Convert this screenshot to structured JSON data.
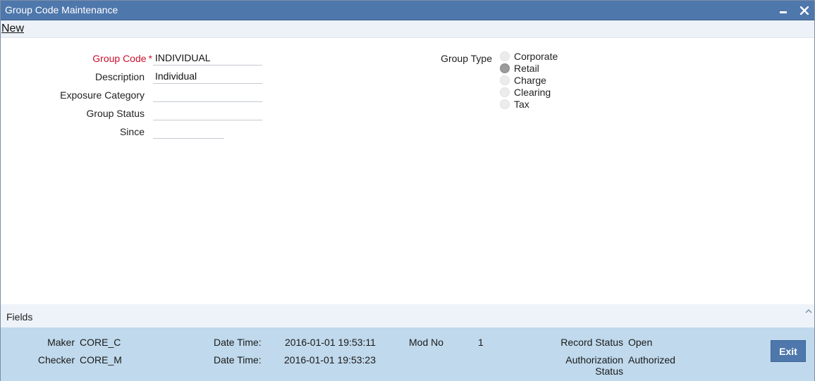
{
  "window": {
    "title": "Group Code Maintenance"
  },
  "menubar": {
    "new_label": "New"
  },
  "form": {
    "group_code": {
      "label": "Group Code",
      "required_mark": "*",
      "value": "INDIVIDUAL"
    },
    "description": {
      "label": "Description",
      "value": "Individual"
    },
    "exposure_category": {
      "label": "Exposure Category",
      "value": ""
    },
    "group_status": {
      "label": "Group Status",
      "value": ""
    },
    "since": {
      "label": "Since",
      "value": ""
    }
  },
  "group_type": {
    "label": "Group Type",
    "options": [
      {
        "label": "Corporate",
        "checked": false
      },
      {
        "label": "Retail",
        "checked": true
      },
      {
        "label": "Charge",
        "checked": false
      },
      {
        "label": "Clearing",
        "checked": false
      },
      {
        "label": "Tax",
        "checked": false
      }
    ]
  },
  "fields_section": {
    "label": "Fields"
  },
  "footer": {
    "maker_label": "Maker",
    "maker_value": "CORE_C",
    "checker_label": "Checker",
    "checker_value": "CORE_M",
    "maker_datetime_label": "Date Time:",
    "maker_datetime_value": "2016-01-01 19:53:11",
    "checker_datetime_label": "Date Time:",
    "checker_datetime_value": "2016-01-01 19:53:23",
    "mod_no_label": "Mod No",
    "mod_no_value": "1",
    "record_status_label": "Record Status",
    "record_status_value": "Open",
    "auth_status_label_line1": "Authorization",
    "auth_status_label_line2": "Status",
    "auth_status_value": "Authorized",
    "exit_label": "Exit"
  },
  "colors": {
    "titlebar": "#4e77ac",
    "footer": "#c0d9ec",
    "required": "#c8102e"
  }
}
